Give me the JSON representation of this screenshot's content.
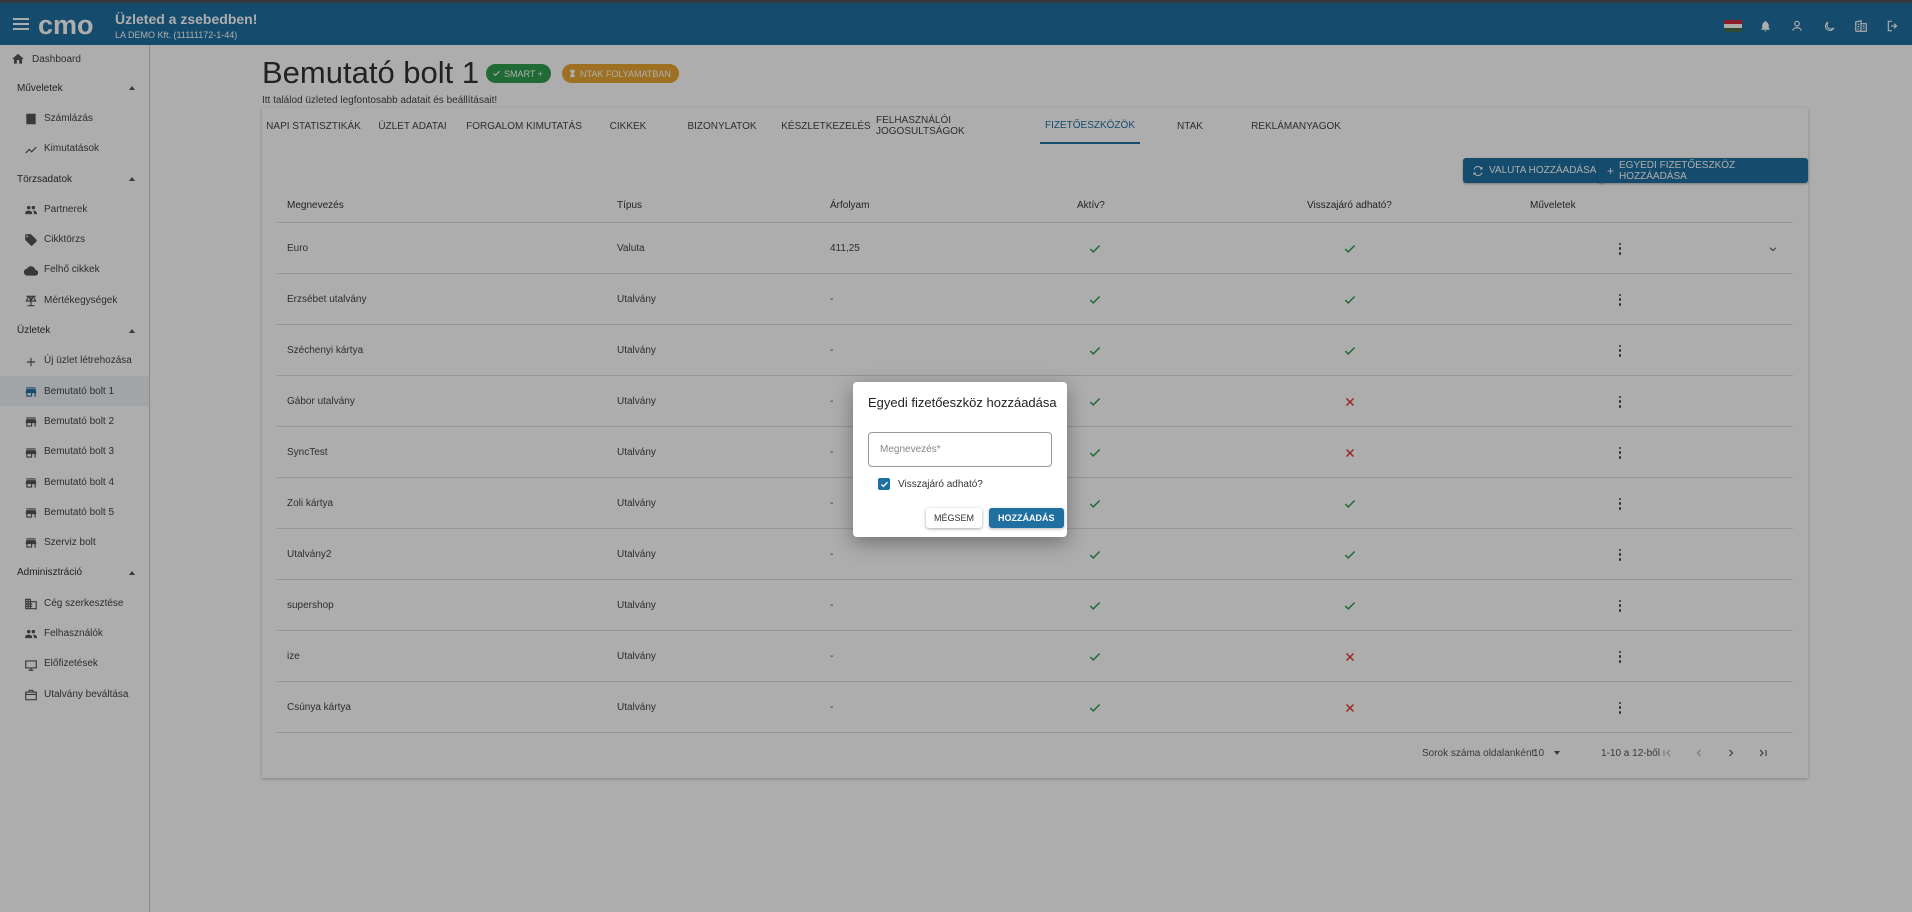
{
  "header": {
    "logo_text": "cmo",
    "title": "Üzleted a zsebedben!",
    "subtitle": "LA DEMO Kft. (11111172-1-44)",
    "icons": [
      "hungary-flag",
      "bell-icon",
      "user-icon",
      "moon-icon",
      "building-icon",
      "logout-icon"
    ]
  },
  "sidebar": {
    "dashboard": "Dashboard",
    "sections": [
      {
        "label": "Műveletek",
        "items": [
          "Számlázás",
          "Kimutatások"
        ]
      },
      {
        "label": "Törzsadatok",
        "items": [
          "Partnerek",
          "Cikktörzs",
          "Felhő cikkek",
          "Mértékegységek"
        ]
      },
      {
        "label": "Üzletek",
        "items": [
          "Új üzlet létrehozása",
          "Bemutató bolt 1",
          "Bemutató bolt 2",
          "Bemutató bolt 3",
          "Bemutató bolt 4",
          "Bemutató bolt 5",
          "Szerviz bolt"
        ]
      },
      {
        "label": "Adminisztráció",
        "items": [
          "Cég szerkesztése",
          "Felhasználók",
          "Előfizetések",
          "Utalvány beváltása"
        ]
      }
    ],
    "active_item": "Bemutató bolt 1"
  },
  "page": {
    "title": "Bemutató bolt 1",
    "badge_smart": "SMART +",
    "badge_ntak": "NTAK FOLYAMATBAN",
    "subtitle": "Itt találod üzleted legfontosabb adatait és beállításait!"
  },
  "tabs": [
    "NAPI STATISZTIKÁK",
    "ÜZLET ADATAI",
    "FORGALOM KIMUTATÁS",
    "CIKKEK",
    "BIZONYLATOK",
    "KÉSZLETKEZELÉS",
    "FELHASZNÁLÓI JOGOSULTSÁGOK",
    "FIZETŐESZKÖZÖK",
    "NTAK",
    "REKLÁMANYAGOK"
  ],
  "active_tab": "FIZETŐESZKÖZÖK",
  "actions": {
    "add_currency": "VALUTA HOZZÁADÁSA",
    "add_custom": "EGYEDI FIZETŐESZKÖZ HOZZÁADÁSA"
  },
  "table": {
    "columns": [
      "Megnevezés",
      "Típus",
      "Árfolyam",
      "Aktív?",
      "Visszajáró adható?",
      "Műveletek"
    ],
    "rows": [
      {
        "name": "Euro",
        "type": "Valuta",
        "rate": "411,25",
        "active": true,
        "change": true
      },
      {
        "name": "Erzsébet utalvány",
        "type": "Utalvány",
        "rate": "-",
        "active": true,
        "change": true
      },
      {
        "name": "Széchenyi kártya",
        "type": "Utalvány",
        "rate": "-",
        "active": true,
        "change": true
      },
      {
        "name": "Gábor utalvány",
        "type": "Utalvány",
        "rate": "-",
        "active": true,
        "change": false
      },
      {
        "name": "SyncTest",
        "type": "Utalvány",
        "rate": "-",
        "active": true,
        "change": false
      },
      {
        "name": "Zoli kártya",
        "type": "Utalvány",
        "rate": "-",
        "active": true,
        "change": true
      },
      {
        "name": "Utalvány2",
        "type": "Utalvány",
        "rate": "-",
        "active": true,
        "change": true
      },
      {
        "name": "supershop",
        "type": "Utalvány",
        "rate": "-",
        "active": true,
        "change": true
      },
      {
        "name": "ize",
        "type": "Utalvány",
        "rate": "-",
        "active": true,
        "change": false
      },
      {
        "name": "Csúnya kártya",
        "type": "Utalvány",
        "rate": "-",
        "active": true,
        "change": false
      }
    ]
  },
  "pagination": {
    "rows_per_page_label": "Sorok száma oldalanként:",
    "rows_per_page": "10",
    "range": "1-10 a 12-ből"
  },
  "dialog": {
    "title": "Egyedi fizetőeszköz hozzáadása",
    "name_placeholder": "Megnevezés*",
    "change_label": "Visszajáró adható?",
    "change_checked": true,
    "cancel": "MÉGSEM",
    "add": "HOZZÁADÁS"
  },
  "colors": {
    "primary": "#1f6fa0",
    "success": "#2e9d4f",
    "warning": "#e8a533",
    "error": "#e53935"
  }
}
